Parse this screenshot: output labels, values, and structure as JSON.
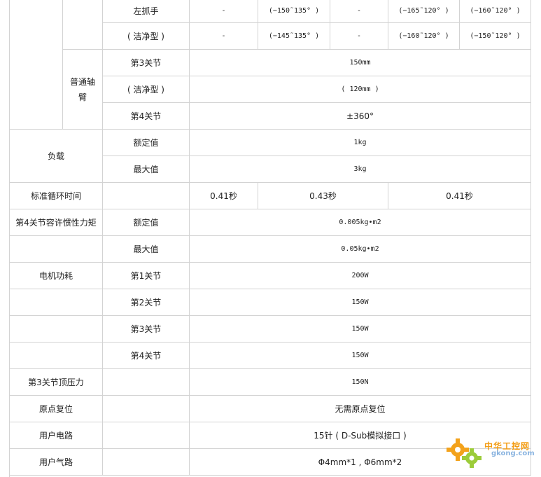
{
  "rows": [
    {
      "key": "zhua",
      "cells": [
        {
          "bind": "grip_label",
          "text": "左抓手"
        },
        {
          "text": "-"
        },
        {
          "text": "(−150˜135° )"
        },
        {
          "text": "-"
        },
        {
          "text": "(−165˜120° )"
        },
        {
          "text": "(−160˜120° )"
        }
      ]
    },
    {
      "key": "clean1",
      "cells": [
        {
          "text": "( 洁净型 )"
        },
        {
          "text": "-"
        },
        {
          "text": "(−145˜135° )"
        },
        {
          "text": "-"
        },
        {
          "text": "(−160˜120° )"
        },
        {
          "text": "(−150˜120° )"
        }
      ]
    }
  ],
  "arm": {
    "label_lines": [
      "普通轴",
      "臂"
    ]
  },
  "joint3": {
    "label": "第3关节",
    "value": "150mm"
  },
  "clean2": {
    "label": "( 洁净型 )",
    "value": "( 120mm )"
  },
  "joint4": {
    "label": "第4关节",
    "value": "±360°"
  },
  "payload": {
    "label": "负载",
    "rated": {
      "label": "额定值",
      "value": "1kg"
    },
    "max": {
      "label": "最大值",
      "value": "3kg"
    }
  },
  "cycle": {
    "label": "标准循环时间",
    "values": [
      "0.41秒",
      "0.43秒",
      "0.41秒"
    ]
  },
  "inertia": {
    "label": "第4关节容许惯性力矩",
    "rated": {
      "label": "额定值",
      "value": "0.005kg•m2"
    },
    "max": {
      "label": "最大值",
      "value": "0.05kg•m2"
    }
  },
  "power": {
    "label": "电机功耗",
    "items": [
      {
        "label": "第1关节",
        "value": "200W"
      },
      {
        "label": "第2关节",
        "value": "150W"
      },
      {
        "label": "第3关节",
        "value": "150W"
      },
      {
        "label": "第4关节",
        "value": "150W"
      }
    ]
  },
  "press": {
    "label": "第3关节顶压力",
    "value": "150N"
  },
  "origin": {
    "label": "原点复位",
    "value": "无需原点复位"
  },
  "circuit": {
    "label": "用户电路",
    "value": "15针 ( D-Sub模拟接口 )"
  },
  "air": {
    "label": "用户气路",
    "value": "Φ4mm*1 , Φ6mm*2"
  },
  "watermark": {
    "cn": "中华工控网",
    "en": "gkong.com"
  }
}
